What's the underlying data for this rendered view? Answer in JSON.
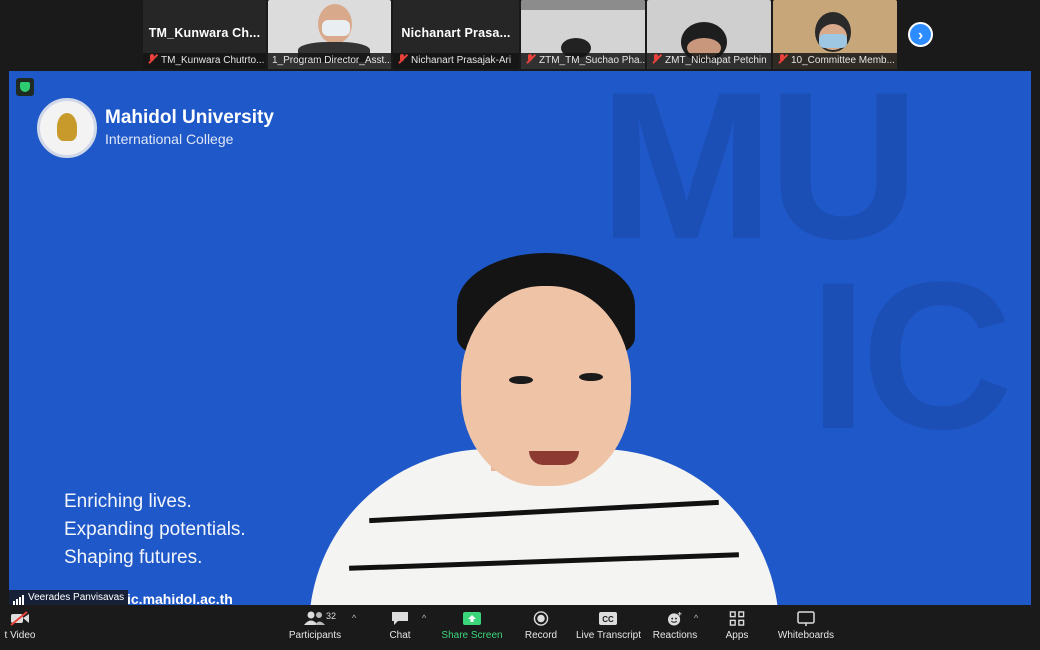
{
  "participants": [
    {
      "name": "TM_Kunwara Ch...",
      "caption": "TM_Kunwara Chutrto...",
      "video": false
    },
    {
      "name": "",
      "caption": "1_Program Director_Asst...",
      "video": true
    },
    {
      "name": "Nichanart Prasa...",
      "caption": "Nichanart Prasajak-Ari",
      "video": false
    },
    {
      "name": "",
      "caption": "ZTM_TM_Suchao Pha...",
      "video": true
    },
    {
      "name": "",
      "caption": "ZMT_Nichapat Petchin",
      "video": true
    },
    {
      "name": "",
      "caption": "10_Committee Memb...",
      "video": true
    }
  ],
  "next_page_icon": "chevron-right-icon",
  "slide": {
    "university": "Mahidol University",
    "college": "International College",
    "bg_letters": [
      "MU",
      "IC"
    ],
    "slogans": [
      "Enriching lives.",
      "Expanding potentials.",
      "Shaping futures."
    ],
    "url": "ic.mahidol.ac.th"
  },
  "speaker": {
    "name": "Veerades Panvisavas"
  },
  "toolbar": {
    "video_label": "t Video",
    "participants_label": "Participants",
    "participants_count": "32",
    "chat_label": "Chat",
    "share_label": "Share Screen",
    "record_label": "Record",
    "transcript_label": "Live Transcript",
    "reactions_label": "Reactions",
    "apps_label": "Apps",
    "whiteboards_label": "Whiteboards",
    "cc_text": "CC"
  },
  "colors": {
    "accent": "#2d8cff",
    "share_green": "#3bd57a",
    "slide_blue": "#1f58c8",
    "mute_red": "#e8423b"
  }
}
